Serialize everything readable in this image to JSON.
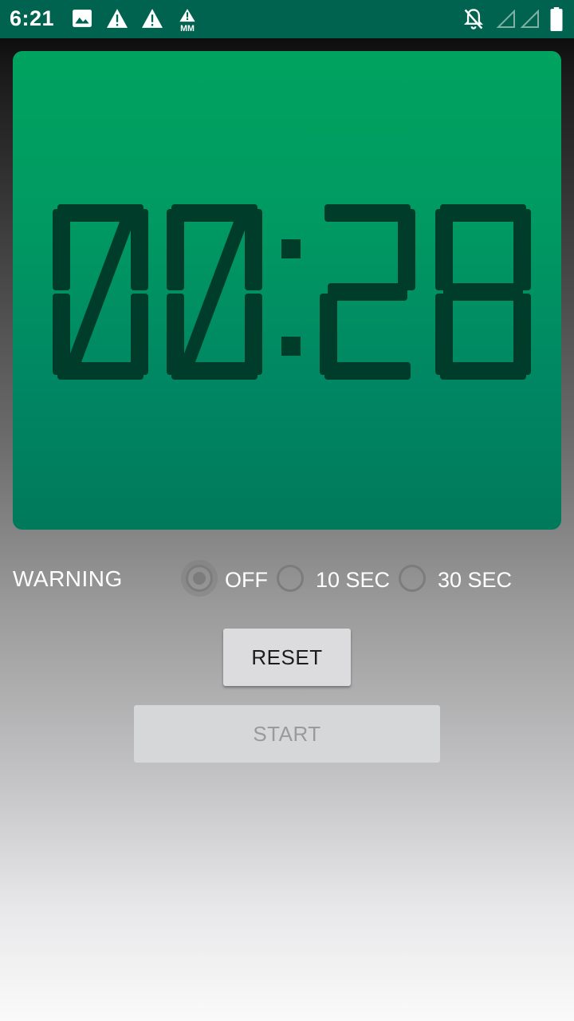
{
  "status_bar": {
    "time": "6:21",
    "background": "#006350",
    "icons_left": [
      "image-icon",
      "warning-icon",
      "warning-icon",
      "mm-warning-icon"
    ],
    "icons_right": [
      "notifications-off-icon",
      "signal-empty-icon",
      "signal-empty-icon",
      "battery-icon"
    ]
  },
  "timer": {
    "display": "00:28",
    "digit_color": "#003c2a",
    "panel_color": "#009a62"
  },
  "warning": {
    "label": "WARNING",
    "options": [
      {
        "label": "OFF",
        "checked": true
      },
      {
        "label": "10 SEC",
        "checked": false
      },
      {
        "label": "30 SEC",
        "checked": false
      }
    ]
  },
  "buttons": {
    "reset": "RESET",
    "start": "START"
  }
}
